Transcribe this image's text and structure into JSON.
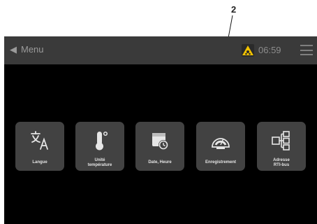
{
  "annotation": {
    "number": "2"
  },
  "topbar": {
    "back_label": "Menu",
    "time": "06:59",
    "alarm_color": "#f2c200"
  },
  "tiles": [
    {
      "label": "Langue",
      "icon": "translate-icon"
    },
    {
      "label": "Unité\ntempérature",
      "icon": "thermometer-icon"
    },
    {
      "label": "Date, Heure",
      "icon": "calendar-clock-icon"
    },
    {
      "label": "Enregistrement",
      "icon": "gauge-icon"
    },
    {
      "label": "Adresse\nRTI-bus",
      "icon": "network-icon"
    }
  ],
  "colors": {
    "screen_bg": "#000000",
    "bar_bg": "#3a3a3a",
    "tile_bg": "#424242",
    "icon": "#e6e6e6"
  }
}
